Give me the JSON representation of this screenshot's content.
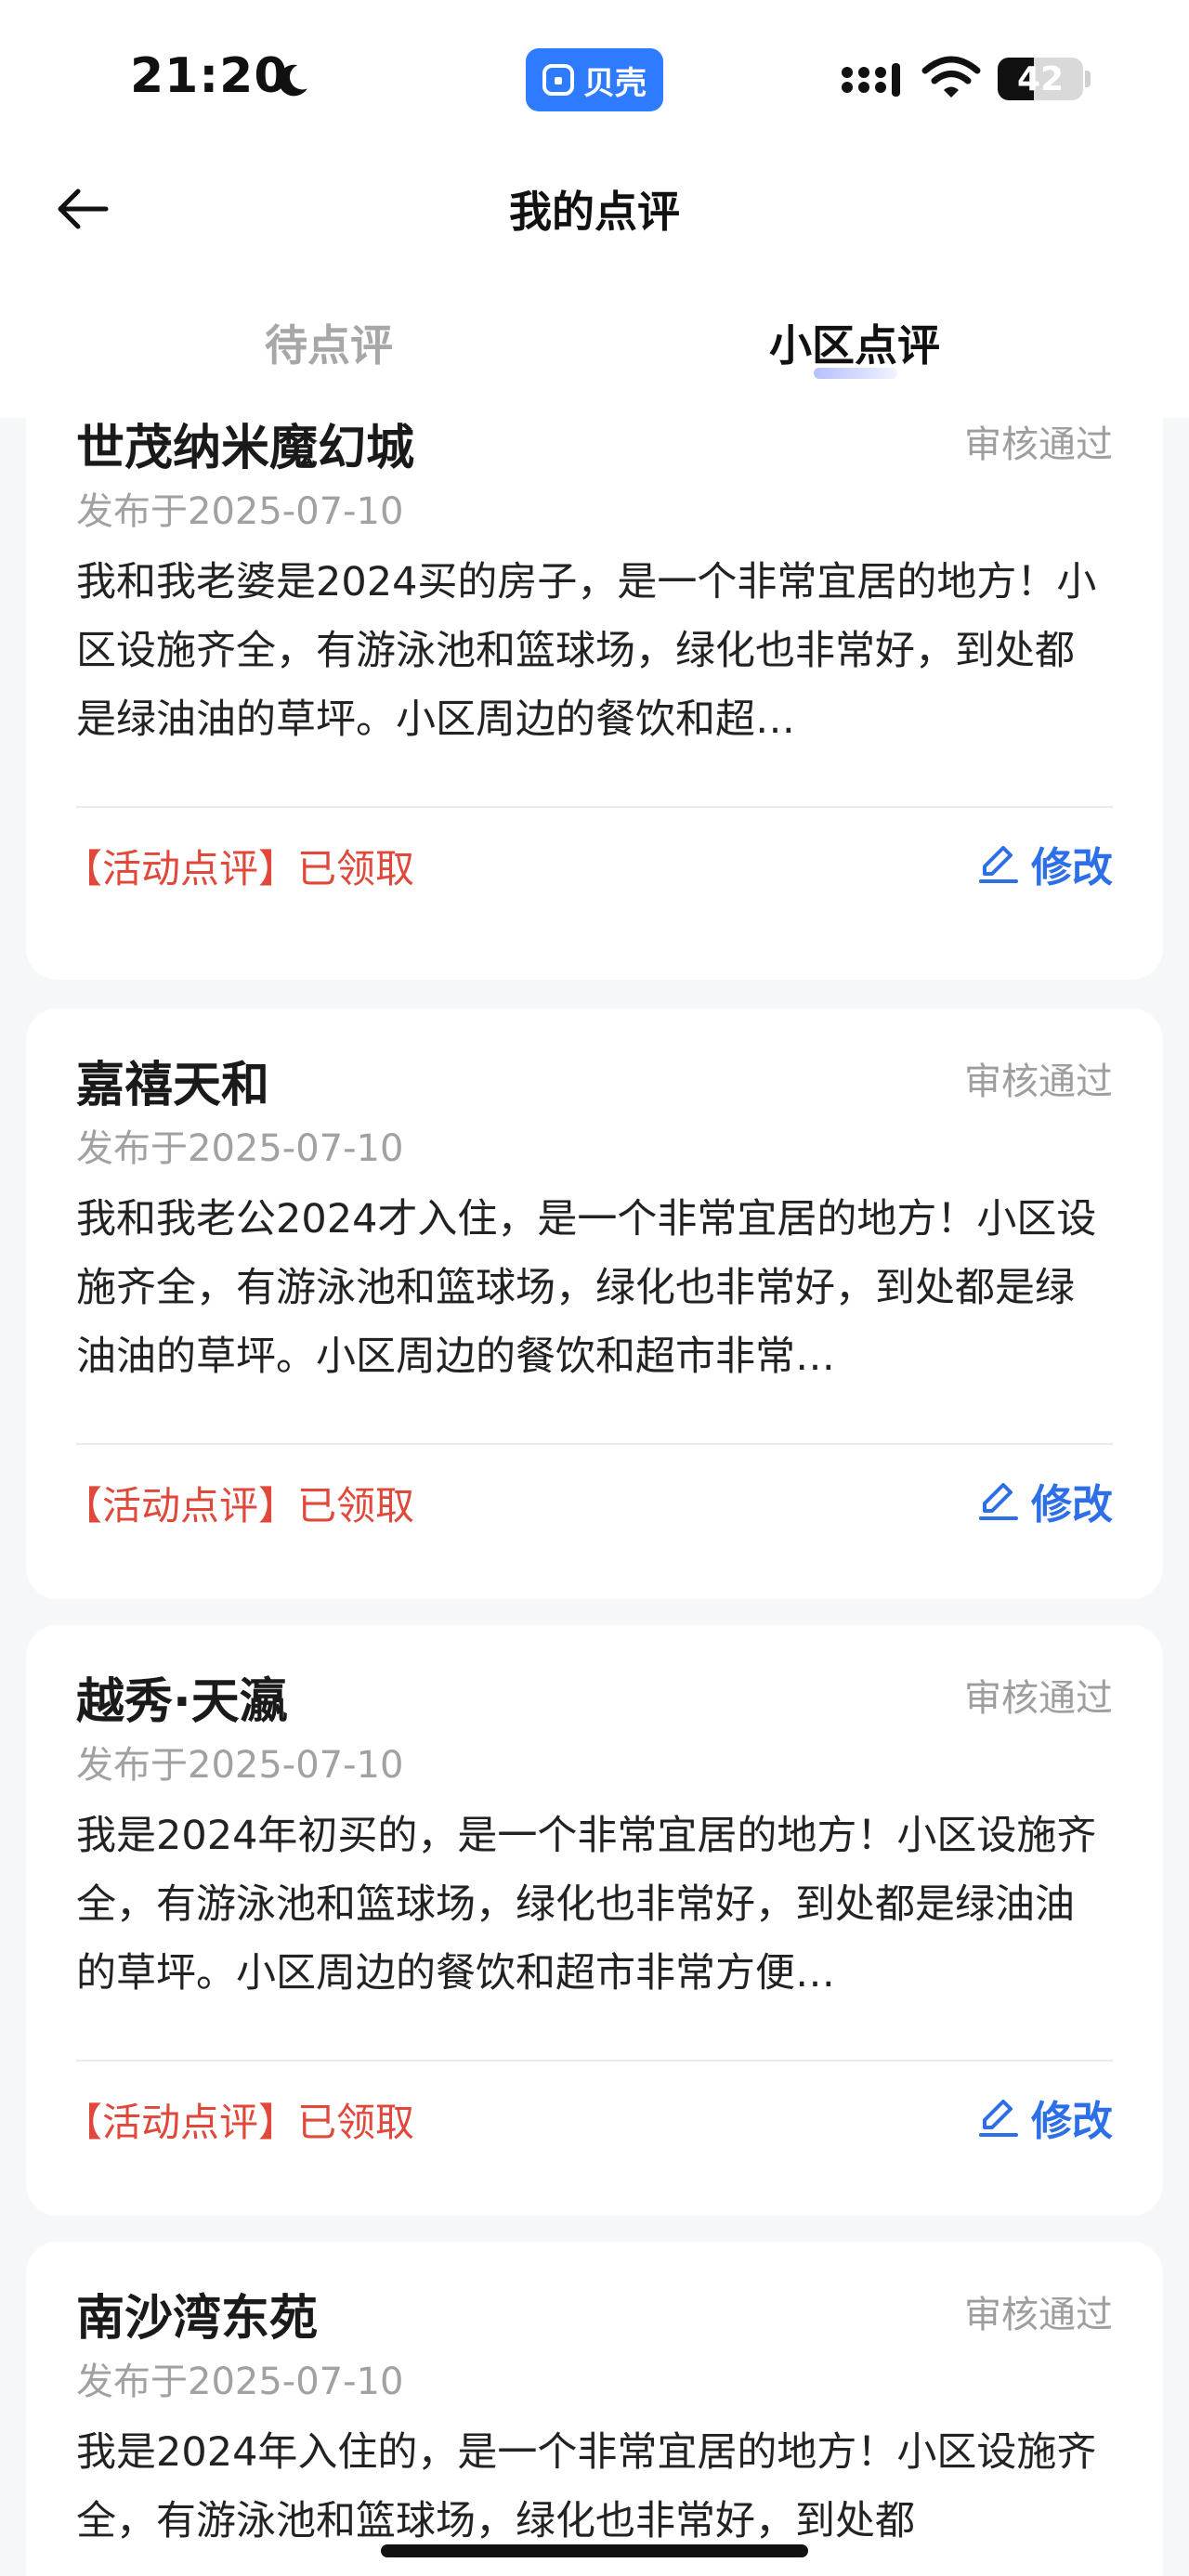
{
  "status_bar": {
    "time": "21:20",
    "app_pill_label": "贝壳",
    "battery": "42"
  },
  "header": {
    "title": "我的点评"
  },
  "tabs": [
    {
      "label": "待点评",
      "active": false
    },
    {
      "label": "小区点评",
      "active": true
    }
  ],
  "reviews": [
    {
      "name": "世茂纳米魔幻城",
      "status": "审核通过",
      "date": "发布于2025-07-10",
      "text": "我和我老婆是2024买的房子，是一个非常宜居的地方！小区设施齐全，有游泳池和篮球场，绿化也非常好，到处都是绿油油的草坪。小区周边的餐饮和超…",
      "tag": "【活动点评】已领取",
      "edit_label": "修改"
    },
    {
      "name": "嘉禧天和",
      "status": "审核通过",
      "date": "发布于2025-07-10",
      "text": "我和我老公2024才入住，是一个非常宜居的地方！小区设施齐全，有游泳池和篮球场，绿化也非常好，到处都是绿油油的草坪。小区周边的餐饮和超市非常…",
      "tag": "【活动点评】已领取",
      "edit_label": "修改"
    },
    {
      "name": "越秀·天瀛",
      "status": "审核通过",
      "date": "发布于2025-07-10",
      "text": "我是2024年初买的，是一个非常宜居的地方！小区设施齐全，有游泳池和篮球场，绿化也非常好，到处都是绿油油的草坪。小区周边的餐饮和超市非常方便…",
      "tag": "【活动点评】已领取",
      "edit_label": "修改"
    },
    {
      "name": "南沙湾东苑",
      "status": "审核通过",
      "date": "发布于2025-07-10",
      "text": "我是2024年入住的，是一个非常宜居的地方！小区设施齐全，有游泳池和篮球场，绿化也非常好，到处都",
      "tag": "",
      "edit_label": ""
    }
  ]
}
